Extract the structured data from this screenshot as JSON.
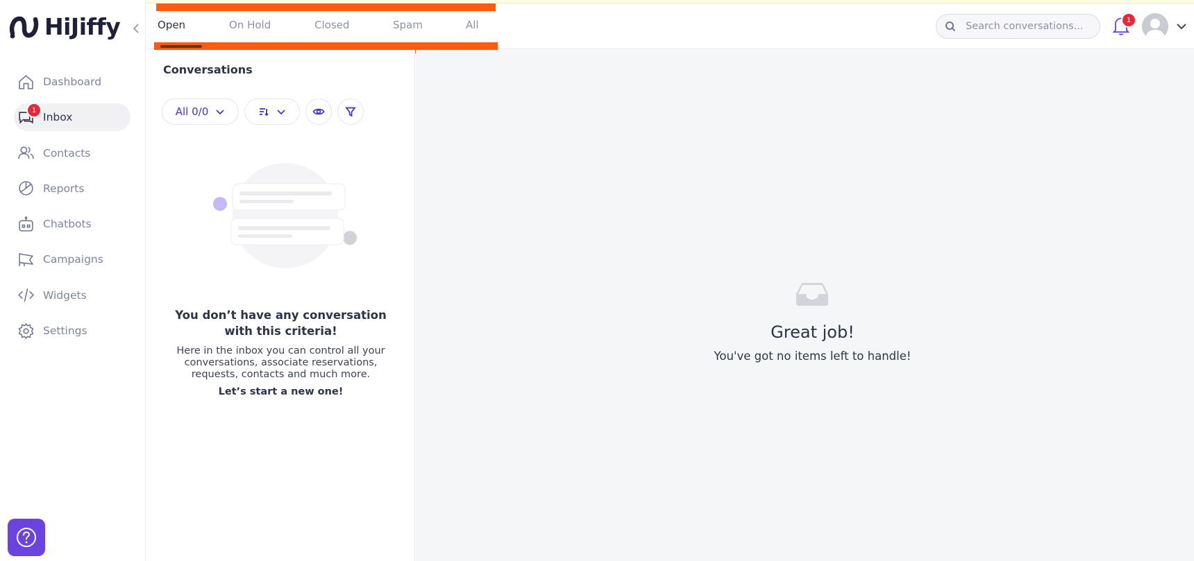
{
  "brand": {
    "name": "HiJiffy",
    "color": "#1e2139",
    "accent": "#6b43e0"
  },
  "sidebar": {
    "collapse_icon": "chevron-left-icon",
    "items": [
      {
        "label": "Dashboard",
        "icon": "home-icon"
      },
      {
        "label": "Inbox",
        "icon": "chat-icon",
        "badge": "1",
        "active": true
      },
      {
        "label": "Contacts",
        "icon": "users-icon"
      },
      {
        "label": "Reports",
        "icon": "pie-chart-icon"
      },
      {
        "label": "Chatbots",
        "icon": "robot-icon"
      },
      {
        "label": "Campaigns",
        "icon": "megaphone-icon"
      },
      {
        "label": "Widgets",
        "icon": "code-icon"
      },
      {
        "label": "Settings",
        "icon": "gear-icon"
      }
    ],
    "help_icon": "question-circle-icon"
  },
  "topbar": {
    "tabs": [
      {
        "label": "Open",
        "active": true
      },
      {
        "label": "On Hold"
      },
      {
        "label": "Closed"
      },
      {
        "label": "Spam"
      },
      {
        "label": "All"
      }
    ],
    "highlight_color": "#ff5a10",
    "search": {
      "placeholder": "Search conversations...",
      "value": ""
    },
    "notifications": {
      "badge": "1"
    }
  },
  "conversations": {
    "title": "Conversations",
    "filter_all_label": "All 0/0",
    "empty_title": "You don’t have any conversation with this criteria!",
    "empty_description": "Here in the inbox you can control all your conversations, associate reservations, requests, contacts and much more.",
    "empty_cta": "Let’s start a new one!"
  },
  "main": {
    "title": "Great job!",
    "subtitle": "You've got no items left to handle!"
  },
  "badge_color": "#e8283a"
}
